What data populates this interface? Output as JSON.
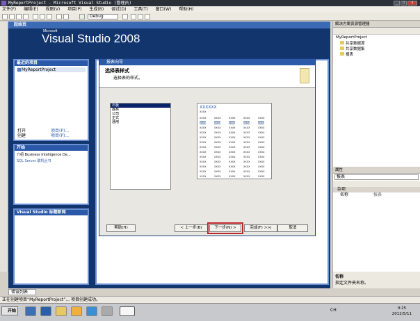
{
  "window": {
    "title": "MyReportProject - Microsoft Visual Studio (管理员)"
  },
  "menu": [
    "文件(F)",
    "编辑(E)",
    "视图(V)",
    "项目(P)",
    "生成(B)",
    "调试(D)",
    "工具(T)",
    "窗口(W)",
    "帮助(H)"
  ],
  "toolbar": {
    "config": "Debug"
  },
  "doc_tab": "起始页",
  "start_page": {
    "logo_ms": "Microsoft",
    "logo": "Visual Studio 2008",
    "recent_header": "最近的项目",
    "recent_item": "MyReportProject",
    "open_label": "打开",
    "create_label": "创建",
    "open_link": "项目(P)...",
    "create_link": "项目(P)...",
    "start_header": "开始",
    "start_item1": "介绍 Business Intelligence De...",
    "start_item2": "SQL Server 联机丛书",
    "news_header": "Visual Studio 标题新闻"
  },
  "dialog": {
    "title": "报表向导",
    "heading": "选择表样式",
    "subheading": "选择表的样式。",
    "styles": [
      "石板",
      "森林",
      "公司",
      "正式",
      "通用"
    ],
    "selected_style": 0,
    "preview_title": "XXXXXX",
    "preview_cell": "xxxx",
    "buttons": {
      "help": "帮助(H)",
      "back": "< 上一步(B)",
      "next": "下一步(N) >",
      "finish": "完成(F) >>|",
      "cancel": "取消"
    }
  },
  "solution_explorer": {
    "title": "解决方案资源管理器",
    "project": "MyReportProject",
    "items": [
      "共享数据源",
      "共享数据集",
      "报表"
    ]
  },
  "properties": {
    "title": "属性",
    "object": "报表",
    "section": "杂项",
    "prop_name": "名称",
    "prop_value": "报表",
    "desc_title": "名称",
    "desc_text": "指定文件夹名称。"
  },
  "error_tab": "错误列表",
  "status": "正在创建项目“MyReportProject”... 项目创建成功。",
  "taskbar": {
    "start": "开始",
    "lang": "CH",
    "time": "9:25",
    "date": "2012/5/11"
  },
  "colors": {
    "accent": "#2b58a8",
    "start_bg": "#12356e",
    "highlight": "#c0272d"
  }
}
